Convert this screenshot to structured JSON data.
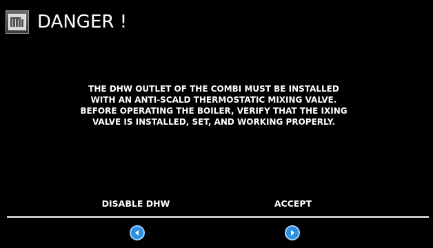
{
  "header": {
    "logo_icon": "brand-logo-icon",
    "title": "DANGER !"
  },
  "message": {
    "lines": [
      "THE DHW OUTLET OF THE COMBI MUST BE INSTALLED",
      "WITH AN ANTI-SCALD THERMOSTATIC MIXING VALVE.",
      "BEFORE OPERATING THE BOILER, VERIFY THAT THE IXING",
      "VALVE IS INSTALLED, SET, AND WORKING PROPERLY."
    ]
  },
  "actions": {
    "left_label": "DISABLE DHW",
    "right_label": "ACCEPT",
    "left_icon": "chevron-left-icon",
    "right_icon": "chevron-right-icon"
  },
  "colors": {
    "background": "#000000",
    "text": "#ffffff",
    "button_accent": "#2f8fe0"
  }
}
